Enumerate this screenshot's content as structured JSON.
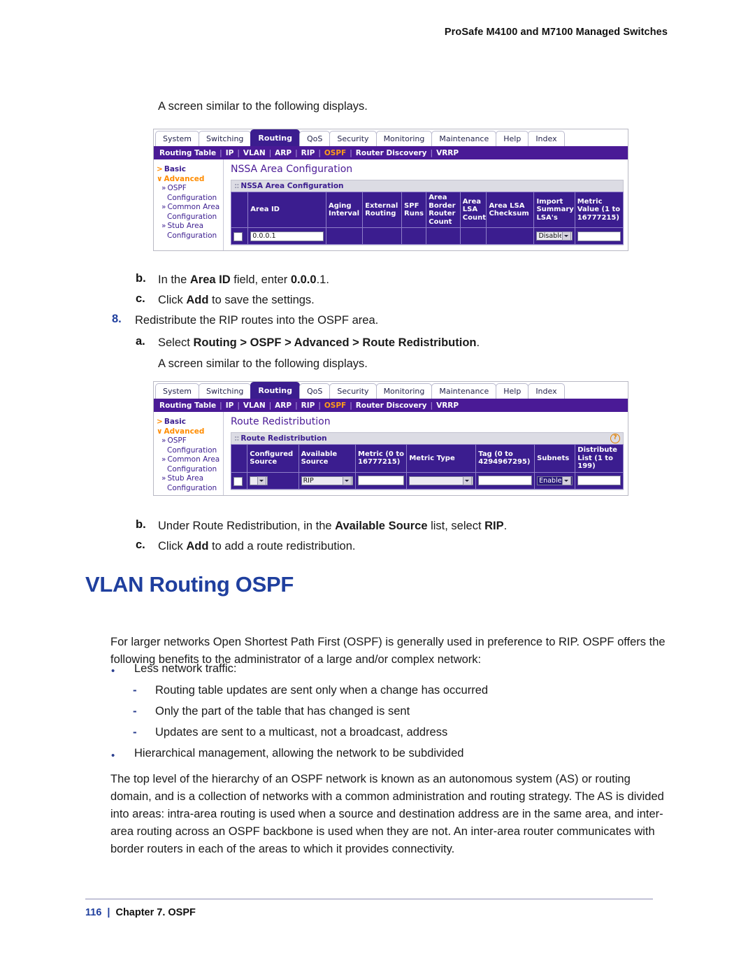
{
  "header": {
    "title": "ProSafe M4100 and M7100 Managed Switches"
  },
  "body": {
    "intro1": "A screen similar to the following displays.",
    "intro2": "A screen similar to the following displays.",
    "step_b1_marker": "b.",
    "step_b1_pre": "In the ",
    "step_b1_bold1": "Area ID",
    "step_b1_mid": " field, enter ",
    "step_b1_bold2": "0.0.0",
    "step_b1_post": ".1.",
    "step_c1_marker": "c.",
    "step_c1_pre": "Click ",
    "step_c1_bold": "Add",
    "step_c1_post": " to save the settings.",
    "step_8_marker": "8.",
    "step_8_text": "Redistribute the RIP routes into the OSPF area.",
    "step_a2_marker": "a.",
    "step_a2_pre": "Select ",
    "step_a2_bold": "Routing > OSPF > Advanced > Route Redistribution",
    "step_a2_post": ".",
    "step_b2_marker": "b.",
    "step_b2_pre": "Under Route Redistribution, in the ",
    "step_b2_bold1": "Available Source",
    "step_b2_mid": " list, select ",
    "step_b2_bold2": "RIP",
    "step_b2_post": ".",
    "step_c2_marker": "c.",
    "step_c2_pre": "Click ",
    "step_c2_bold": "Add",
    "step_c2_post": " to add a route redistribution.",
    "heading": "VLAN Routing OSPF",
    "para1": "For larger networks Open Shortest Path First (OSPF) is generally used in preference to RIP. OSPF offers the following benefits to the administrator of a large and/or complex network:",
    "bullet1": "Less network traffic:",
    "sub1": "Routing table updates are sent only when a change has occurred",
    "sub2": "Only the part of the table that has changed is sent",
    "sub3": "Updates are sent to a multicast, not a broadcast, address",
    "bullet2": "Hierarchical management, allowing the network to be subdivided",
    "para2": "The top level of the hierarchy of an OSPF network is known as an autonomous system (AS) or routing domain, and is a collection of networks with a common administration and routing strategy. The AS is divided into areas: intra-area routing is used when a source and destination address are in the same area, and inter-area routing across an OSPF backbone is used when they are not. An inter-area router communicates with border routers in each of the areas to which it provides connectivity."
  },
  "footer": {
    "page_number": "116",
    "separator": "|",
    "chapter": "Chapter 7. OSPF"
  },
  "screenshot1": {
    "tabs": [
      "System",
      "Switching",
      "Routing",
      "QoS",
      "Security",
      "Monitoring",
      "Maintenance",
      "Help",
      "Index"
    ],
    "active_tab": "Routing",
    "subnav": [
      "Routing Table",
      "IP",
      "VLAN",
      "ARP",
      "RIP",
      "OSPF",
      "Router Discovery",
      "VRRP"
    ],
    "subnav_active": "OSPF",
    "sidebar": [
      {
        "label": "Basic",
        "level": 1,
        "marker": ">",
        "style": "basic"
      },
      {
        "label": "Advanced",
        "level": 1,
        "marker": "ˇ",
        "style": "advanced"
      },
      {
        "label": "OSPF",
        "level": 2,
        "marker": "»"
      },
      {
        "label": "Configuration",
        "level": 3
      },
      {
        "label": "Common Area",
        "level": 2,
        "marker": "»"
      },
      {
        "label": "Configuration",
        "level": 3
      },
      {
        "label": "Stub Area",
        "level": 2,
        "marker": "»"
      },
      {
        "label": "Configuration",
        "level": 3
      }
    ],
    "page_title": "NSSA Area Configuration",
    "panel_title": "NSSA Area Configuration",
    "has_help_icon": false,
    "columns": [
      "",
      "Area ID",
      "Aging Interval",
      "External Routing",
      "SPF Runs",
      "Area Border Router Count",
      "Area LSA Count",
      "Area LSA Checksum",
      "Import Summary LSA's",
      "Metric Value (1 to 16777215)"
    ],
    "row": {
      "checkbox": false,
      "area_id": "0.0.0.1",
      "aging_interval": "",
      "external_routing": "",
      "spf_runs": "",
      "area_border_router_count": "",
      "area_lsa_count": "",
      "area_lsa_checksum": "",
      "import_summary_lsas": "Disable",
      "metric_value": ""
    }
  },
  "screenshot2": {
    "tabs": [
      "System",
      "Switching",
      "Routing",
      "QoS",
      "Security",
      "Monitoring",
      "Maintenance",
      "Help",
      "Index"
    ],
    "active_tab": "Routing",
    "subnav": [
      "Routing Table",
      "IP",
      "VLAN",
      "ARP",
      "RIP",
      "OSPF",
      "Router Discovery",
      "VRRP"
    ],
    "subnav_active": "OSPF",
    "sidebar": [
      {
        "label": "Basic",
        "level": 1,
        "marker": ">",
        "style": "basic"
      },
      {
        "label": "Advanced",
        "level": 1,
        "marker": "ˇ",
        "style": "advanced"
      },
      {
        "label": "OSPF",
        "level": 2,
        "marker": "»"
      },
      {
        "label": "Configuration",
        "level": 3
      },
      {
        "label": "Common Area",
        "level": 2,
        "marker": "»"
      },
      {
        "label": "Configuration",
        "level": 3
      },
      {
        "label": "Stub Area",
        "level": 2,
        "marker": "»"
      },
      {
        "label": "Configuration",
        "level": 3
      }
    ],
    "page_title": "Route Redistribution",
    "panel_title": "Route Redistribution",
    "has_help_icon": true,
    "help_icon_label": "?",
    "columns": [
      "",
      "Configured Source",
      "Available Source",
      "Metric (0 to 16777215)",
      "Metric Type",
      "Tag (0 to 4294967295)",
      "Subnets",
      "Distribute List (1 to 199)"
    ],
    "row": {
      "checkbox": false,
      "configured_source": "",
      "available_source": "RIP",
      "metric": "",
      "metric_type": "",
      "tag": "",
      "subnets": "Enable",
      "distribute_list": ""
    }
  },
  "colors": {
    "nav_purple": "#4a1a96",
    "tab_active": "#3b1d8f",
    "accent_orange": "#ff8c00",
    "heading_blue": "#1f3f9e"
  }
}
